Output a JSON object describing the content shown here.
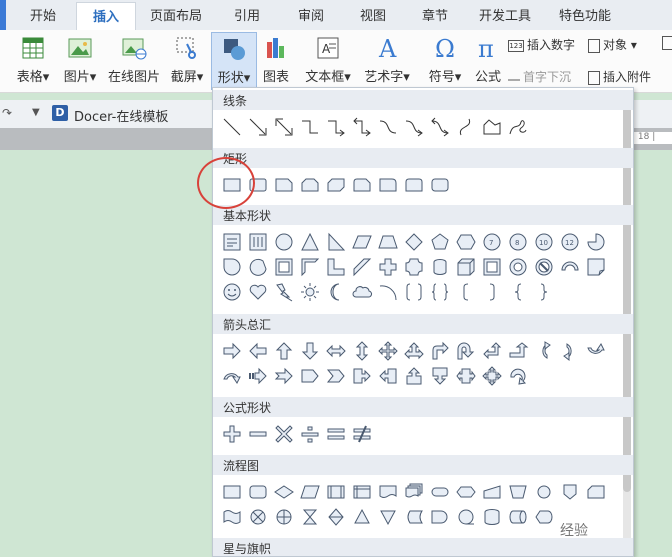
{
  "tabs": [
    "开始",
    "插入",
    "页面布局",
    "引用",
    "审阅",
    "视图",
    "章节",
    "开发工具",
    "特色功能"
  ],
  "active_tab": "插入",
  "ribbon": {
    "table": "表格",
    "picture": "图片",
    "online_picture": "在线图片",
    "screenshot": "截屏",
    "shapes": "形状",
    "chart": "图表",
    "textbox": "文本框",
    "wordart": "艺术字",
    "symbol": "符号",
    "formula": "公式",
    "insert_number": "插入数字",
    "object": "对象",
    "dropcap": "首字下沉",
    "attachment": "插入附件"
  },
  "doc_tab": {
    "name": "Docer-在线模板"
  },
  "ruler_text": "| 18 |",
  "panel": {
    "sections": [
      "线条",
      "矩形",
      "基本形状",
      "箭头总汇",
      "公式形状",
      "流程图",
      "星与旗帜"
    ]
  },
  "watermark": "经验",
  "colors": {
    "accent": "#2e6fbf",
    "panel_header": "#e8ecf2",
    "circle": "#d8423a",
    "bg": "#cfe6d3"
  }
}
